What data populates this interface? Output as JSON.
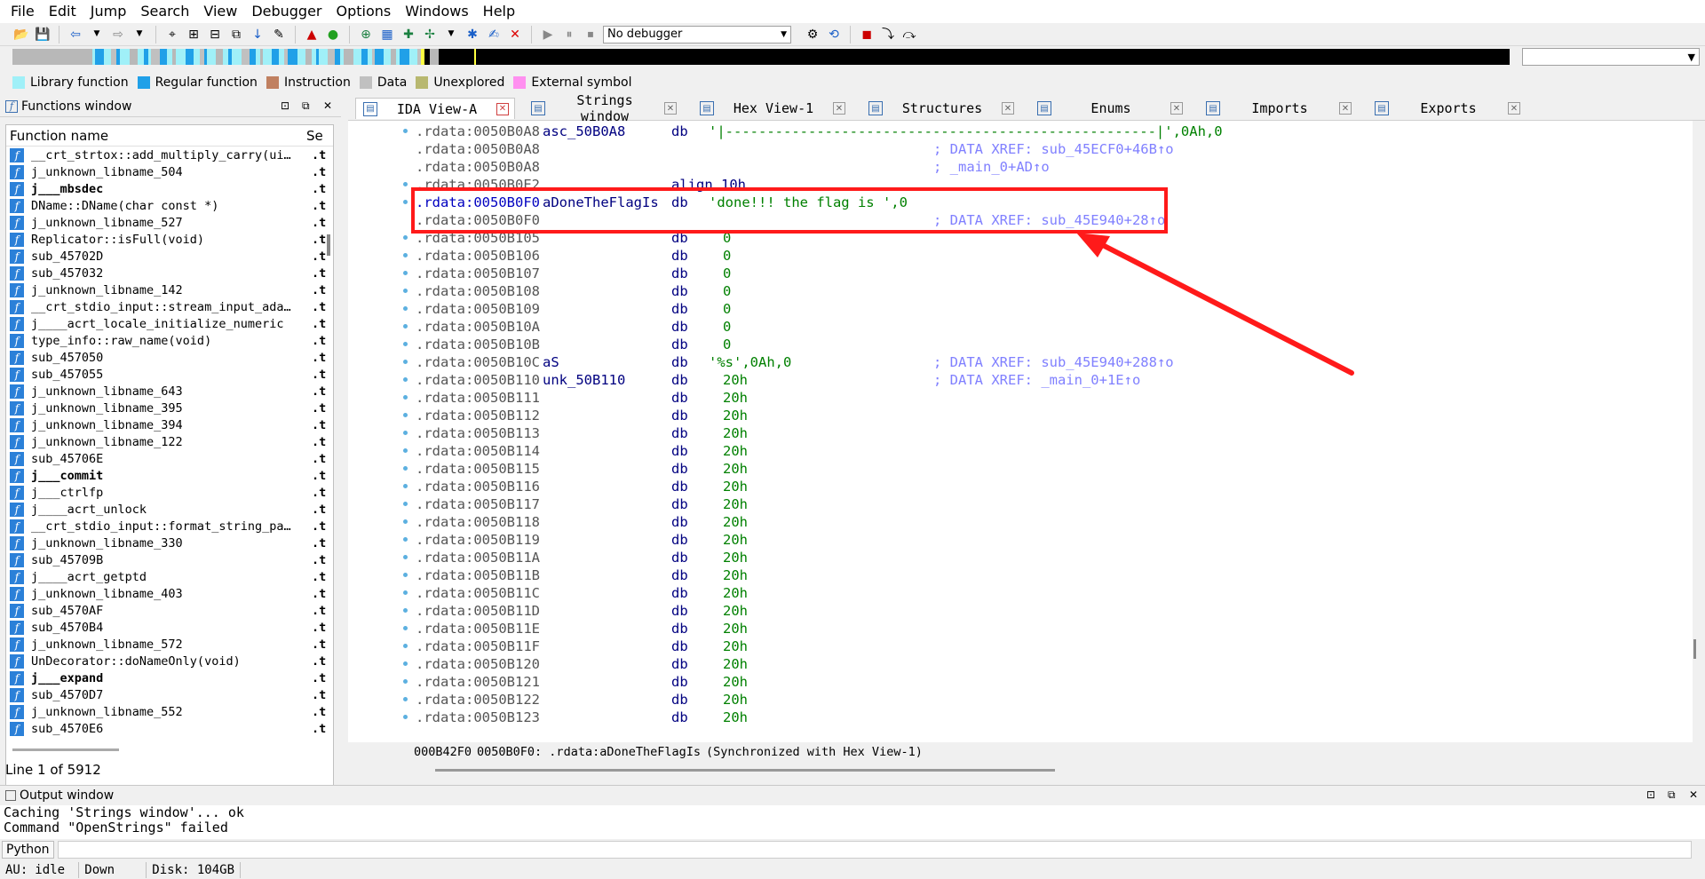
{
  "menu": [
    "File",
    "Edit",
    "Jump",
    "Search",
    "View",
    "Debugger",
    "Options",
    "Windows",
    "Help"
  ],
  "toolbar": {
    "debugger_label": "No debugger",
    "icons": [
      "open-icon",
      "save-icon",
      "back-icon",
      "forward-icon",
      "debug-run-icon",
      "pause-icon",
      "stop-icon"
    ]
  },
  "legend": [
    {
      "label": "Library function",
      "color": "#a0f0f8"
    },
    {
      "label": "Regular function",
      "color": "#20a0e8"
    },
    {
      "label": "Instruction",
      "color": "#c08060"
    },
    {
      "label": "Data",
      "color": "#c0c0c0"
    },
    {
      "label": "Unexplored",
      "color": "#b8b870"
    },
    {
      "label": "External symbol",
      "color": "#ff90f0"
    }
  ],
  "functions": {
    "title": "Functions window",
    "col_name": "Function name",
    "col_seg": "Se",
    "status": "Line 1 of 5912",
    "rows": [
      {
        "name": "__crt_strtox::add_multiply_carry(ui…",
        "seg": ".t",
        "bold": false
      },
      {
        "name": "j_unknown_libname_504",
        "seg": ".t",
        "bold": false
      },
      {
        "name": "j___mbsdec",
        "seg": ".t",
        "bold": true
      },
      {
        "name": "DName::DName(char const *)",
        "seg": ".t",
        "bold": false
      },
      {
        "name": "j_unknown_libname_527",
        "seg": ".t",
        "bold": false
      },
      {
        "name": "Replicator::isFull(void)",
        "seg": ".t",
        "bold": false
      },
      {
        "name": "sub_45702D",
        "seg": ".t",
        "bold": false
      },
      {
        "name": "sub_457032",
        "seg": ".t",
        "bold": false
      },
      {
        "name": "j_unknown_libname_142",
        "seg": ".t",
        "bold": false
      },
      {
        "name": "__crt_stdio_input::stream_input_ada…",
        "seg": ".t",
        "bold": false
      },
      {
        "name": "j____acrt_locale_initialize_numeric",
        "seg": ".t",
        "bold": false
      },
      {
        "name": "type_info::raw_name(void)",
        "seg": ".t",
        "bold": false
      },
      {
        "name": "sub_457050",
        "seg": ".t",
        "bold": false
      },
      {
        "name": "sub_457055",
        "seg": ".t",
        "bold": false
      },
      {
        "name": "j_unknown_libname_643",
        "seg": ".t",
        "bold": false
      },
      {
        "name": "j_unknown_libname_395",
        "seg": ".t",
        "bold": false
      },
      {
        "name": "j_unknown_libname_394",
        "seg": ".t",
        "bold": false
      },
      {
        "name": "j_unknown_libname_122",
        "seg": ".t",
        "bold": false
      },
      {
        "name": "sub_45706E",
        "seg": ".t",
        "bold": false
      },
      {
        "name": "j___commit",
        "seg": ".t",
        "bold": true
      },
      {
        "name": "j___ctrlfp",
        "seg": ".t",
        "bold": false
      },
      {
        "name": "j____acrt_unlock",
        "seg": ".t",
        "bold": false
      },
      {
        "name": "__crt_stdio_input::format_string_pa…",
        "seg": ".t",
        "bold": false
      },
      {
        "name": "j_unknown_libname_330",
        "seg": ".t",
        "bold": false
      },
      {
        "name": "sub_45709B",
        "seg": ".t",
        "bold": false
      },
      {
        "name": "j____acrt_getptd",
        "seg": ".t",
        "bold": false
      },
      {
        "name": "j_unknown_libname_403",
        "seg": ".t",
        "bold": false
      },
      {
        "name": "sub_4570AF",
        "seg": ".t",
        "bold": false
      },
      {
        "name": "sub_4570B4",
        "seg": ".t",
        "bold": false
      },
      {
        "name": "j_unknown_libname_572",
        "seg": ".t",
        "bold": false
      },
      {
        "name": "UnDecorator::doNameOnly(void)",
        "seg": ".t",
        "bold": false
      },
      {
        "name": "j___expand",
        "seg": ".t",
        "bold": true
      },
      {
        "name": "sub_4570D7",
        "seg": ".t",
        "bold": false
      },
      {
        "name": "j_unknown_libname_552",
        "seg": ".t",
        "bold": false
      },
      {
        "name": "sub_4570E6",
        "seg": ".t",
        "bold": false
      }
    ]
  },
  "tabs": [
    {
      "label": "IDA View-A",
      "active": true,
      "icon": "ida-view-icon"
    },
    {
      "label": "Strings window",
      "active": false,
      "icon": "strings-icon"
    },
    {
      "label": "Hex View-1",
      "active": false,
      "icon": "hex-view-icon"
    },
    {
      "label": "Structures",
      "active": false,
      "icon": "structures-icon"
    },
    {
      "label": "Enums",
      "active": false,
      "icon": "enums-icon"
    },
    {
      "label": "Imports",
      "active": false,
      "icon": "imports-icon"
    },
    {
      "label": "Exports",
      "active": false,
      "icon": "exports-icon"
    }
  ],
  "code_lines": [
    {
      "addr": ".rdata:0050B0A8",
      "label": "asc_50B0A8",
      "mnem": "db",
      "operand": "'|----------------------------------------------------|',0Ah,0",
      "xref": "",
      "dot": true,
      "hi": false
    },
    {
      "addr": ".rdata:0050B0A8",
      "label": "",
      "mnem": "",
      "operand": "",
      "xref": "; DATA XREF: sub_45ECF0+46B↑o",
      "dot": false,
      "hi": false
    },
    {
      "addr": ".rdata:0050B0A8",
      "label": "",
      "mnem": "",
      "operand": "",
      "xref": "; _main_0+AD↑o",
      "dot": false,
      "hi": false
    },
    {
      "addr": ".rdata:0050B0E2",
      "label": "",
      "mnem": "align 10h",
      "operand": "",
      "xref": "",
      "dot": true,
      "hi": false
    },
    {
      "addr": ".rdata:0050B0F0",
      "label": "aDoneTheFlagIs",
      "mnem": "db",
      "operand": "'done!!! the flag is ',0",
      "xref": "",
      "dot": true,
      "hi": true
    },
    {
      "addr": ".rdata:0050B0F0",
      "label": "",
      "mnem": "",
      "operand": "",
      "xref": "; DATA XREF: sub_45E940+28↑o",
      "dot": false,
      "hi": false
    },
    {
      "addr": ".rdata:0050B105",
      "label": "",
      "mnem": "db",
      "operand": "0",
      "xref": "",
      "dot": true,
      "hi": false
    },
    {
      "addr": ".rdata:0050B106",
      "label": "",
      "mnem": "db",
      "operand": "0",
      "xref": "",
      "dot": true,
      "hi": false
    },
    {
      "addr": ".rdata:0050B107",
      "label": "",
      "mnem": "db",
      "operand": "0",
      "xref": "",
      "dot": true,
      "hi": false
    },
    {
      "addr": ".rdata:0050B108",
      "label": "",
      "mnem": "db",
      "operand": "0",
      "xref": "",
      "dot": true,
      "hi": false
    },
    {
      "addr": ".rdata:0050B109",
      "label": "",
      "mnem": "db",
      "operand": "0",
      "xref": "",
      "dot": true,
      "hi": false
    },
    {
      "addr": ".rdata:0050B10A",
      "label": "",
      "mnem": "db",
      "operand": "0",
      "xref": "",
      "dot": true,
      "hi": false
    },
    {
      "addr": ".rdata:0050B10B",
      "label": "",
      "mnem": "db",
      "operand": "0",
      "xref": "",
      "dot": true,
      "hi": false
    },
    {
      "addr": ".rdata:0050B10C",
      "label": "aS",
      "mnem": "db",
      "operand": "'%s',0Ah,0",
      "xref": "; DATA XREF: sub_45E940+288↑o",
      "dot": true,
      "hi": false
    },
    {
      "addr": ".rdata:0050B110",
      "label": "unk_50B110",
      "mnem": "db",
      "operand": "20h",
      "xref": "; DATA XREF: _main_0+1E↑o",
      "dot": true,
      "hi": false
    },
    {
      "addr": ".rdata:0050B111",
      "label": "",
      "mnem": "db",
      "operand": "20h",
      "xref": "",
      "dot": true,
      "hi": false
    },
    {
      "addr": ".rdata:0050B112",
      "label": "",
      "mnem": "db",
      "operand": "20h",
      "xref": "",
      "dot": true,
      "hi": false
    },
    {
      "addr": ".rdata:0050B113",
      "label": "",
      "mnem": "db",
      "operand": "20h",
      "xref": "",
      "dot": true,
      "hi": false
    },
    {
      "addr": ".rdata:0050B114",
      "label": "",
      "mnem": "db",
      "operand": "20h",
      "xref": "",
      "dot": true,
      "hi": false
    },
    {
      "addr": ".rdata:0050B115",
      "label": "",
      "mnem": "db",
      "operand": "20h",
      "xref": "",
      "dot": true,
      "hi": false
    },
    {
      "addr": ".rdata:0050B116",
      "label": "",
      "mnem": "db",
      "operand": "20h",
      "xref": "",
      "dot": true,
      "hi": false
    },
    {
      "addr": ".rdata:0050B117",
      "label": "",
      "mnem": "db",
      "operand": "20h",
      "xref": "",
      "dot": true,
      "hi": false
    },
    {
      "addr": ".rdata:0050B118",
      "label": "",
      "mnem": "db",
      "operand": "20h",
      "xref": "",
      "dot": true,
      "hi": false
    },
    {
      "addr": ".rdata:0050B119",
      "label": "",
      "mnem": "db",
      "operand": "20h",
      "xref": "",
      "dot": true,
      "hi": false
    },
    {
      "addr": ".rdata:0050B11A",
      "label": "",
      "mnem": "db",
      "operand": "20h",
      "xref": "",
      "dot": true,
      "hi": false
    },
    {
      "addr": ".rdata:0050B11B",
      "label": "",
      "mnem": "db",
      "operand": "20h",
      "xref": "",
      "dot": true,
      "hi": false
    },
    {
      "addr": ".rdata:0050B11C",
      "label": "",
      "mnem": "db",
      "operand": "20h",
      "xref": "",
      "dot": true,
      "hi": false
    },
    {
      "addr": ".rdata:0050B11D",
      "label": "",
      "mnem": "db",
      "operand": "20h",
      "xref": "",
      "dot": true,
      "hi": false
    },
    {
      "addr": ".rdata:0050B11E",
      "label": "",
      "mnem": "db",
      "operand": "20h",
      "xref": "",
      "dot": true,
      "hi": false
    },
    {
      "addr": ".rdata:0050B11F",
      "label": "",
      "mnem": "db",
      "operand": "20h",
      "xref": "",
      "dot": true,
      "hi": false
    },
    {
      "addr": ".rdata:0050B120",
      "label": "",
      "mnem": "db",
      "operand": "20h",
      "xref": "",
      "dot": true,
      "hi": false
    },
    {
      "addr": ".rdata:0050B121",
      "label": "",
      "mnem": "db",
      "operand": "20h",
      "xref": "",
      "dot": true,
      "hi": false
    },
    {
      "addr": ".rdata:0050B122",
      "label": "",
      "mnem": "db",
      "operand": "20h",
      "xref": "",
      "dot": true,
      "hi": false
    },
    {
      "addr": ".rdata:0050B123",
      "label": "",
      "mnem": "db",
      "operand": "20h",
      "xref": "",
      "dot": true,
      "hi": false
    }
  ],
  "ida_status": {
    "offset": "000B42F0",
    "location": "0050B0F0: .rdata:aDoneTheFlagIs",
    "sync": "(Synchronized with Hex View-1)"
  },
  "output": {
    "title": "Output window",
    "lines": [
      "Caching 'Strings window'... ok",
      "Command \"OpenStrings\" failed"
    ],
    "python_label": "Python"
  },
  "statusbar": {
    "au": "AU:",
    "state": "idle",
    "direction": "Down",
    "disk": "Disk: 104GB"
  },
  "colors": {
    "highlight": "#ff1a1a",
    "code_label": "#000080",
    "code_string": "#008000",
    "xref": "#8080ff"
  }
}
